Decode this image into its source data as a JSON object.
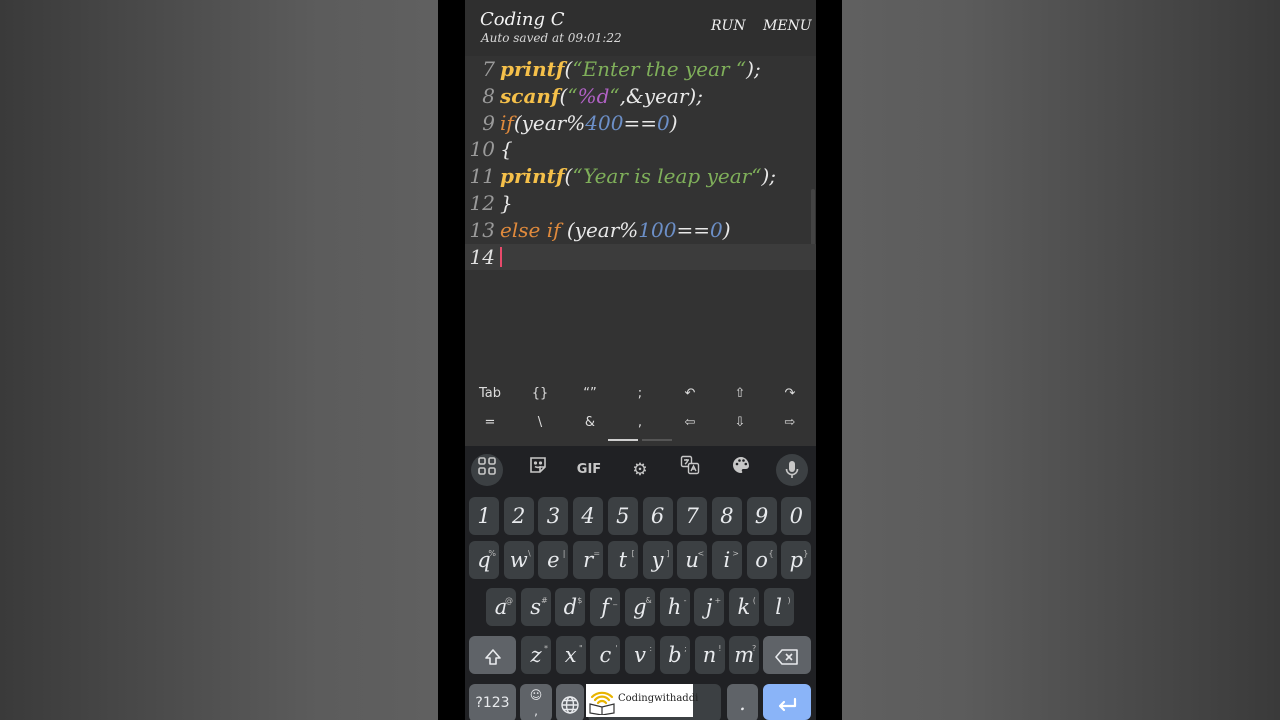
{
  "app": {
    "title": "Coding C",
    "autosave": "Auto saved at 09:01:22",
    "run_label": "RUN",
    "menu_label": "MENU"
  },
  "editor": {
    "lines": [
      {
        "n": "7",
        "tokens": [
          [
            "fn",
            "printf"
          ],
          [
            "pl",
            "("
          ],
          [
            "str",
            "“Enter the year “"
          ],
          [
            "pl",
            ");"
          ]
        ]
      },
      {
        "n": "8",
        "tokens": [
          [
            "fn",
            "scanf"
          ],
          [
            "pl",
            "("
          ],
          [
            "str",
            "“"
          ],
          [
            "fmt",
            "%d"
          ],
          [
            "str",
            "“"
          ],
          [
            "pl",
            ",&year);"
          ]
        ]
      },
      {
        "n": "9",
        "tokens": [
          [
            "kw",
            "if"
          ],
          [
            "pl",
            "(year%"
          ],
          [
            "num",
            "400"
          ],
          [
            "pl",
            "=="
          ],
          [
            "num",
            "0"
          ],
          [
            "pl",
            ")"
          ]
        ]
      },
      {
        "n": "10",
        "tokens": [
          [
            "pl",
            "{"
          ]
        ]
      },
      {
        "n": "11",
        "tokens": [
          [
            "fn",
            "printf"
          ],
          [
            "pl",
            "("
          ],
          [
            "str",
            "“Year is leap year“"
          ],
          [
            "pl",
            ");"
          ]
        ]
      },
      {
        "n": "12",
        "tokens": [
          [
            "pl",
            "}"
          ]
        ]
      },
      {
        "n": "13",
        "tokens": [
          [
            "kw",
            "else if "
          ],
          [
            "pl",
            "(year%"
          ],
          [
            "num",
            "100"
          ],
          [
            "pl",
            "=="
          ],
          [
            "num",
            "0"
          ],
          [
            "pl",
            ")"
          ]
        ]
      },
      {
        "n": "14",
        "tokens": []
      }
    ],
    "current_line": "14"
  },
  "symbols": {
    "row1": [
      "Tab",
      "{}",
      "“”",
      ";",
      "↶",
      "⇧",
      "↷"
    ],
    "row2": [
      "=",
      "\\",
      "&",
      ",",
      "⇦",
      "⇩",
      "⇨"
    ]
  },
  "keyboard": {
    "toolbar": {
      "apps_icon": "grid-icon",
      "sticker_icon": "sticker-icon",
      "gif_label": "GIF",
      "settings_icon": "gear-icon",
      "translate_icon": "translate-icon",
      "theme_icon": "palette-icon",
      "mic_icon": "microphone-icon"
    },
    "numbers": [
      "1",
      "2",
      "3",
      "4",
      "5",
      "6",
      "7",
      "8",
      "9",
      "0"
    ],
    "row1": [
      [
        "q",
        "%"
      ],
      [
        "w",
        "\\"
      ],
      [
        "e",
        "|"
      ],
      [
        "r",
        "="
      ],
      [
        "t",
        "["
      ],
      [
        "y",
        "]"
      ],
      [
        "u",
        "<"
      ],
      [
        "i",
        ">"
      ],
      [
        "o",
        "{"
      ],
      [
        "p",
        "}"
      ]
    ],
    "row2": [
      [
        "a",
        "@"
      ],
      [
        "s",
        "#"
      ],
      [
        "d",
        "$"
      ],
      [
        "f",
        "_"
      ],
      [
        "g",
        "&"
      ],
      [
        "h",
        "-"
      ],
      [
        "j",
        "+"
      ],
      [
        "k",
        "("
      ],
      [
        "l",
        ")"
      ]
    ],
    "row3": [
      [
        "z",
        "*"
      ],
      [
        "x",
        "\""
      ],
      [
        "c",
        "'"
      ],
      [
        "v",
        ":"
      ],
      [
        "b",
        ";"
      ],
      [
        "n",
        "!"
      ],
      [
        "m",
        "?"
      ]
    ],
    "bottom": {
      "symbols_label": "?123",
      "emoji_hint": "☺",
      "comma": ",",
      "period": ".",
      "globe_icon": "globe-icon",
      "enter_icon": "enter-icon",
      "shift_icon": "shift-icon",
      "backspace_icon": "backspace-icon"
    }
  },
  "watermark": {
    "text": "Codingwithaddi"
  },
  "colors": {
    "function": "#f5c04a",
    "keyword": "#e08a3c",
    "string": "#7faf5a",
    "format": "#b061c4",
    "number": "#6c8fc7",
    "caret": "#e84a6b",
    "enter_key": "#8ab4f8"
  }
}
